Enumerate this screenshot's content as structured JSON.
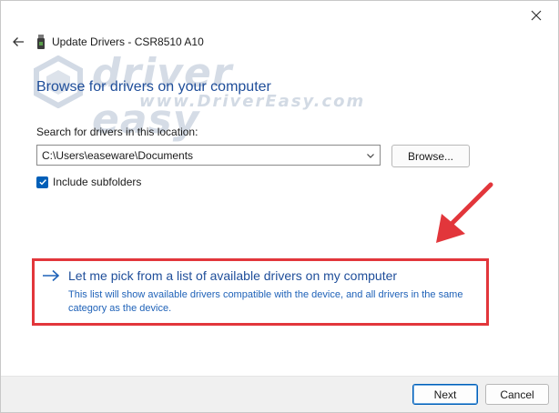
{
  "window": {
    "title": "Update Drivers - CSR8510 A10",
    "close_icon": "close-icon",
    "back_icon": "back-arrow-icon",
    "device_icon": "bluetooth-dongle-icon"
  },
  "watermark": {
    "brand": "driver easy",
    "url": "www.DriverEasy.com",
    "logo_icon": "driver-easy-logo"
  },
  "main": {
    "heading": "Browse for drivers on your computer",
    "search_label": "Search for drivers in this location:",
    "path_value": "C:\\Users\\easeware\\Documents",
    "browse_label": "Browse...",
    "include_subfolders_label": "Include subfolders",
    "include_subfolders_checked": true
  },
  "pick_option": {
    "title": "Let me pick from a list of available drivers on my computer",
    "description": "This list will show available drivers compatible with the device, and all drivers in the same category as the device.",
    "arrow_icon": "right-arrow-icon"
  },
  "annotation": {
    "color": "#e2363b",
    "arrow_icon": "red-pointer-arrow"
  },
  "footer": {
    "next_label": "Next",
    "cancel_label": "Cancel"
  },
  "colors": {
    "accent": "#005fb8",
    "heading": "#1f4e9a",
    "highlight": "#e2363b"
  }
}
